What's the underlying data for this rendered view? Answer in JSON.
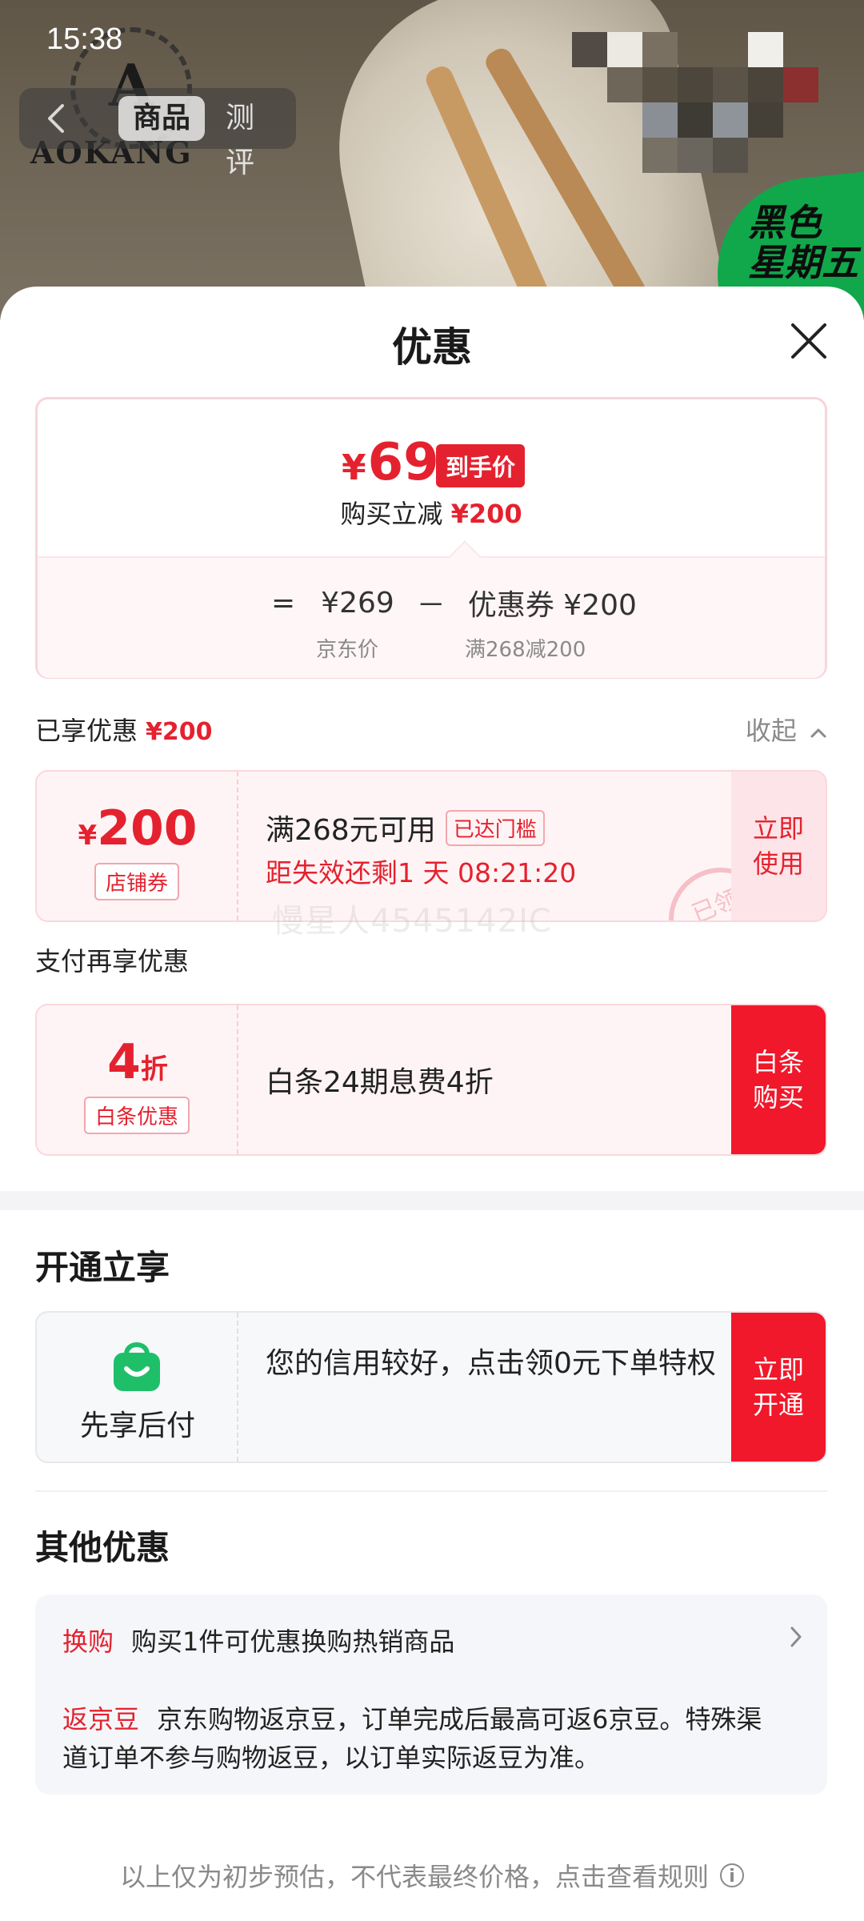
{
  "status_bar": {
    "time": "15:38"
  },
  "hero": {
    "brand_name": "AOKANG",
    "brand_initial": "A",
    "promo_badge": "黑色\n星期五",
    "tabs": [
      {
        "label": "商品",
        "active": true
      },
      {
        "label": "测评",
        "active": false
      }
    ]
  },
  "sheet": {
    "title": "优惠",
    "price_card": {
      "currency": "¥",
      "final_price": "69",
      "final_tag": "到手价",
      "instant_label": "购买立减",
      "instant_amount": "¥200",
      "equals": "=",
      "jd_price": "¥269",
      "minus": "－",
      "coupon_label": "优惠券 ¥200",
      "jd_price_caption": "京东价",
      "coupon_caption": "满268减200"
    },
    "enjoyed": {
      "label": "已享优惠",
      "amount": "¥200",
      "collapse_label": "收起"
    },
    "store_coupon": {
      "currency": "¥",
      "amount": "200",
      "tag": "店铺券",
      "condition": "满268元可用",
      "reached": "已达门槛",
      "countdown": "距失效还剩1 天 08:21:20",
      "action": "立即\n使用",
      "stamp": "已领"
    },
    "watermark": "慢星人4545142IC",
    "pay_section_title": "支付再享优惠",
    "baitiao_coupon": {
      "amount": "4",
      "unit": "折",
      "tag": "白条优惠",
      "description": "白条24期息费4折",
      "action": "白条\n购买"
    },
    "open_section_title": "开通立享",
    "credit": {
      "label": "先享后付",
      "description": "您的信用较好，点击领0元下单特权",
      "action": "立即\n开通",
      "icon_color": "#1fbf6a"
    },
    "other_section_title": "其他优惠",
    "other": {
      "exchange_label": "换购",
      "exchange_text": "购买1件可优惠换购热销商品",
      "beans_label": "返京豆",
      "beans_text": "京东购物返京豆，订单完成后最高可返6京豆。特殊渠道订单不参与购物返豆，以订单实际返豆为准。"
    },
    "footer_note": "以上仅为初步预估，不代表最终价格，点击查看规则"
  },
  "colors": {
    "accent_red": "#e4222f",
    "button_red": "#f0182a",
    "coupon_bg": "#fff4f5"
  }
}
